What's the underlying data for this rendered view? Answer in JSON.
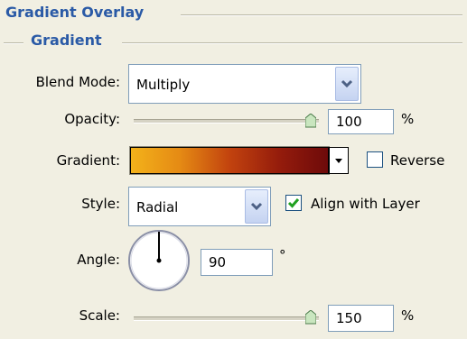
{
  "panel": {
    "section_title": "Gradient Overlay",
    "group_title": "Gradient"
  },
  "fields": {
    "blend_mode": {
      "label": "Blend Mode:",
      "value": "Multiply"
    },
    "opacity": {
      "label": "Opacity:",
      "value": "100",
      "unit": "%",
      "slider_level": 1.0
    },
    "gradient": {
      "label": "Gradient:",
      "stops": [
        "#f3b21a",
        "#e58a14",
        "#c2430e",
        "#951c0c",
        "#6e0a0a"
      ]
    },
    "reverse": {
      "label": "Reverse",
      "checked": false
    },
    "style": {
      "label": "Style:",
      "value": "Radial"
    },
    "align_with_layer": {
      "label": "Align with Layer",
      "checked": true
    },
    "angle": {
      "label": "Angle:",
      "value": "90",
      "unit": "°"
    },
    "scale": {
      "label": "Scale:",
      "value": "150",
      "unit": "%",
      "slider_level": 1.0
    }
  },
  "colors": {
    "title_blue": "#2a5aa6",
    "panel_bg": "#f1efe2",
    "check_green": "#21a121"
  }
}
